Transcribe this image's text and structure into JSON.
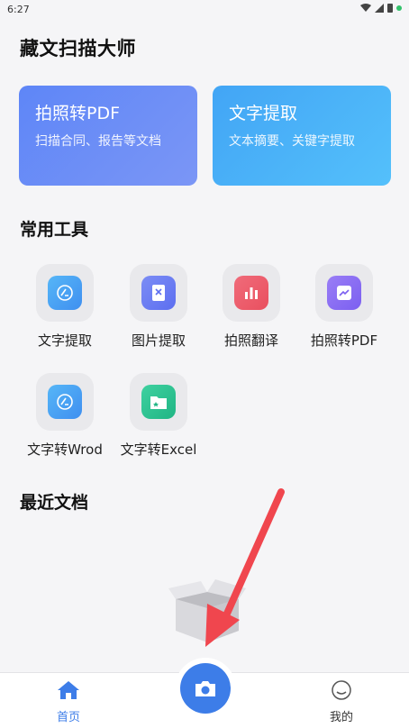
{
  "status": {
    "time": "6:27"
  },
  "app_title": "藏文扫描大师",
  "cards": [
    {
      "title": "拍照转PDF",
      "desc": "扫描合同、报告等文档"
    },
    {
      "title": "文字提取",
      "desc": "文本摘要、关键字提取"
    }
  ],
  "tools_title": "常用工具",
  "tools": [
    {
      "label": "文字提取",
      "icon": "text-extract-icon"
    },
    {
      "label": "图片提取",
      "icon": "image-extract-icon"
    },
    {
      "label": "拍照翻译",
      "icon": "translate-icon"
    },
    {
      "label": "拍照转PDF",
      "icon": "photo-pdf-icon"
    },
    {
      "label": "文字转Wrod",
      "icon": "text-to-word-icon"
    },
    {
      "label": "文字转Excel",
      "icon": "text-to-excel-icon"
    }
  ],
  "recent_title": "最近文档",
  "nav": {
    "home": "首页",
    "mine": "我的"
  },
  "colors": {
    "accent": "#3d7de8"
  }
}
